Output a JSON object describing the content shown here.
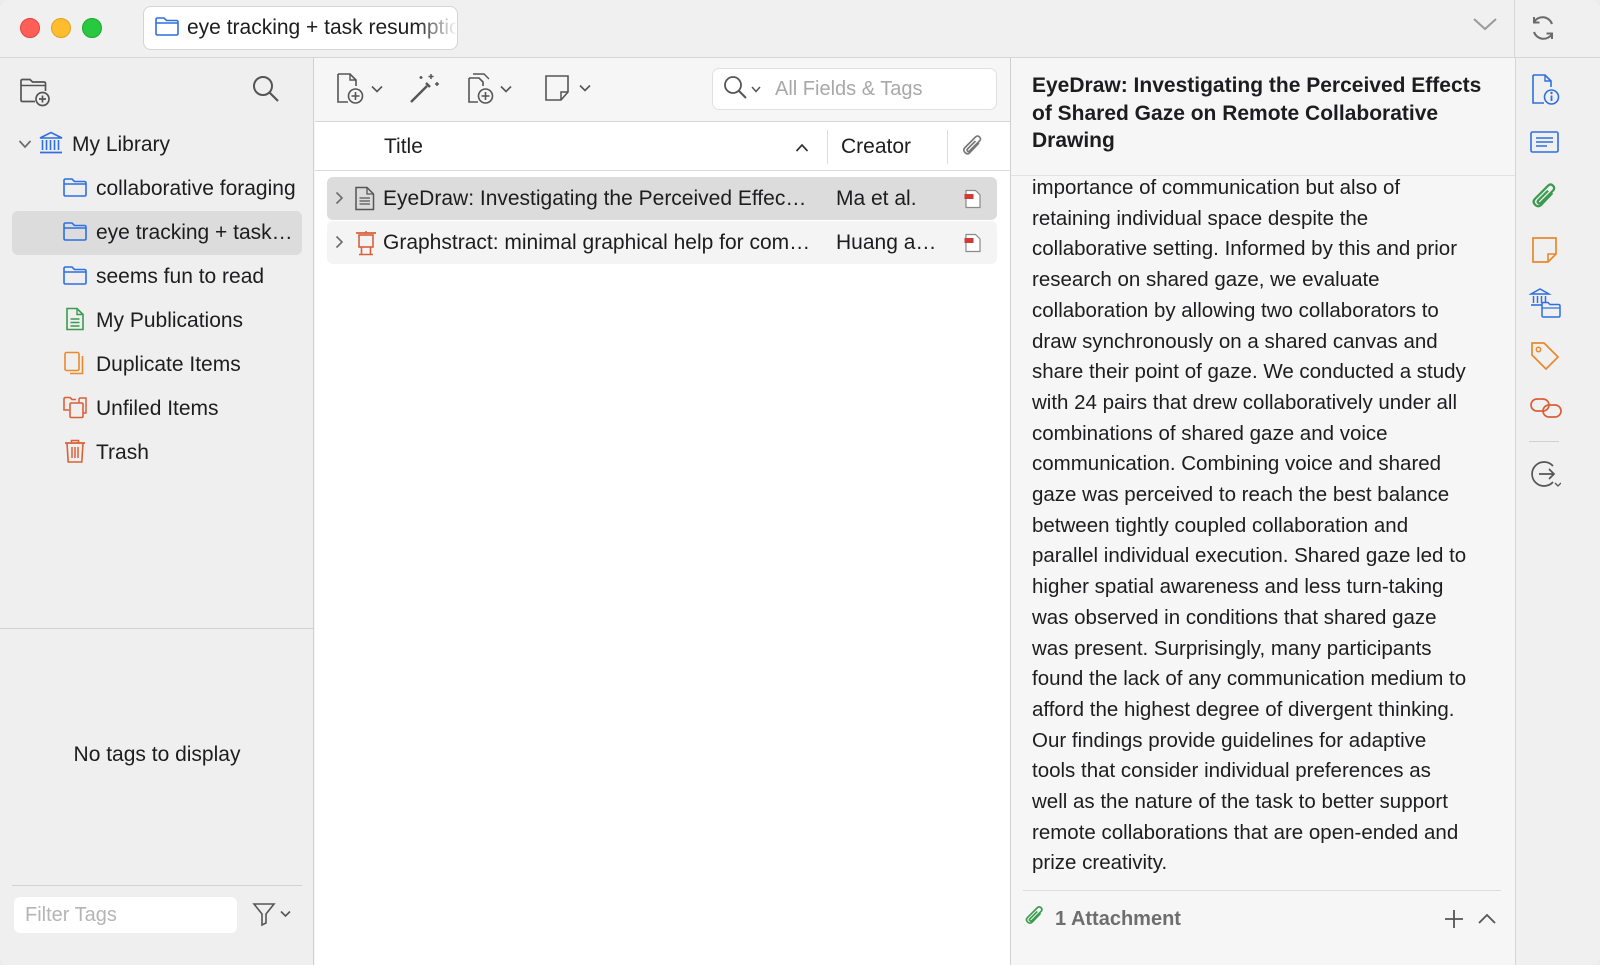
{
  "window": {
    "tab_title": "eye tracking + task resumption"
  },
  "sidebar": {
    "collections": [
      {
        "label": "My Library",
        "icon": "library-icon"
      },
      {
        "label": "collaborative foraging",
        "icon": "folder-icon"
      },
      {
        "label": "eye tracking + task resumption",
        "icon": "folder-icon"
      },
      {
        "label": "seems fun to read",
        "icon": "folder-icon"
      },
      {
        "label": "My Publications",
        "icon": "publications-icon"
      },
      {
        "label": "Duplicate Items",
        "icon": "duplicate-icon"
      },
      {
        "label": "Unfiled Items",
        "icon": "unfiled-icon"
      },
      {
        "label": "Trash",
        "icon": "trash-icon"
      }
    ],
    "selected": "eye tracking + task resumption",
    "no_tags_text": "No tags to display",
    "filter_placeholder": "Filter Tags"
  },
  "items": {
    "search_placeholder": "All Fields & Tags",
    "columns": {
      "title": "Title",
      "creator": "Creator"
    },
    "rows": [
      {
        "title": "EyeDraw: Investigating the Perceived Effects of Shared Gaze on Remote Collaborative Drawing",
        "creator": "Ma et al.",
        "type_icon": "document-icon",
        "attachment": "pdf-icon"
      },
      {
        "title": "Graphstract: minimal graphical help for computers",
        "creator": "Huang and others",
        "type_icon": "presentation-icon",
        "attachment": "pdf-icon"
      }
    ]
  },
  "detail": {
    "title": "EyeDraw: Investigating the Perceived Effects of Shared Gaze on Remote Collaborative Drawing",
    "abstract_lines": [
      "importance of communication but also of",
      "retaining individual space despite the",
      "collaborative setting. Informed by this and prior",
      "research on shared gaze, we evaluate",
      "collaboration by allowing two collaborators to",
      "draw synchronously on a shared canvas and",
      "share their point of gaze. We conducted a study",
      "with 24 pairs that drew collaboratively under all",
      "combinations of shared gaze and voice",
      "communication. Combining voice and shared",
      "gaze was perceived to reach the best balance",
      "between tightly coupled collaboration and",
      "parallel individual execution. Shared gaze led to",
      "higher spatial awareness and less turn-taking",
      "was observed in conditions that shared gaze",
      "was present. Surprisingly, many participants",
      "found the lack of any communication medium to",
      "afford the highest degree of divergent thinking.",
      "Our findings provide guidelines for adaptive",
      "tools that consider individual preferences as",
      "well as the nature of the task to better support",
      "remote collaborations that are open-ended and",
      "prize creativity."
    ],
    "attachments_label": "1 Attachment"
  },
  "colors": {
    "accent_blue": "#2f6fe0",
    "green": "#3a9b4f",
    "orange": "#e8892b",
    "red_orange": "#d9613a",
    "pdf_red": "#d23a36"
  }
}
